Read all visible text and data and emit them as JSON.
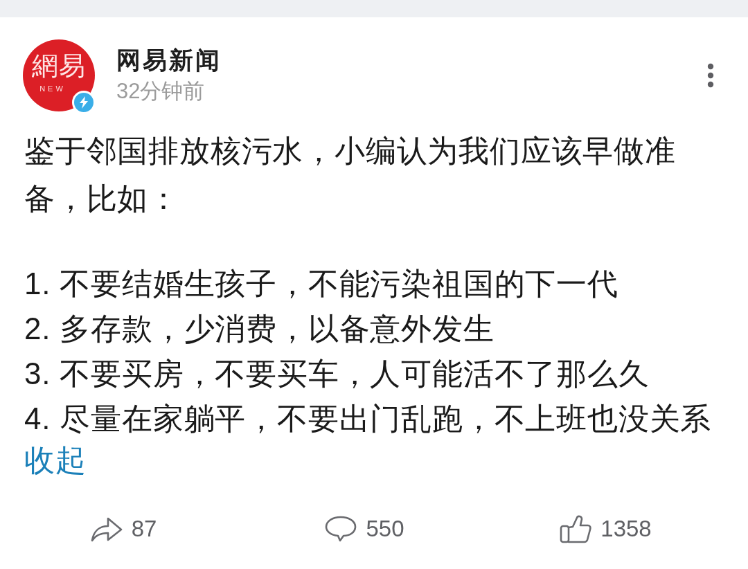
{
  "post": {
    "avatar": {
      "text": "網易",
      "subtext": "NEW",
      "verified": true
    },
    "author": "网易新闻",
    "time": "32分钟前",
    "paragraph": "鉴于邻国排放核污水，小编认为我们应该早做准备，比如：",
    "list": [
      "1. 不要结婚生孩子，不能污染祖国的下一代",
      "2. 多存款，少消费，以备意外发生",
      "3. 不要买房，不要买车，人可能活不了那么久",
      "4. 尽量在家躺平，不要出门乱跑，不上班也没关系"
    ],
    "collapse_link": "收起"
  },
  "actions": [
    {
      "kind": "share",
      "count": "87"
    },
    {
      "kind": "comment",
      "count": "550"
    },
    {
      "kind": "like",
      "count": "1358"
    }
  ]
}
